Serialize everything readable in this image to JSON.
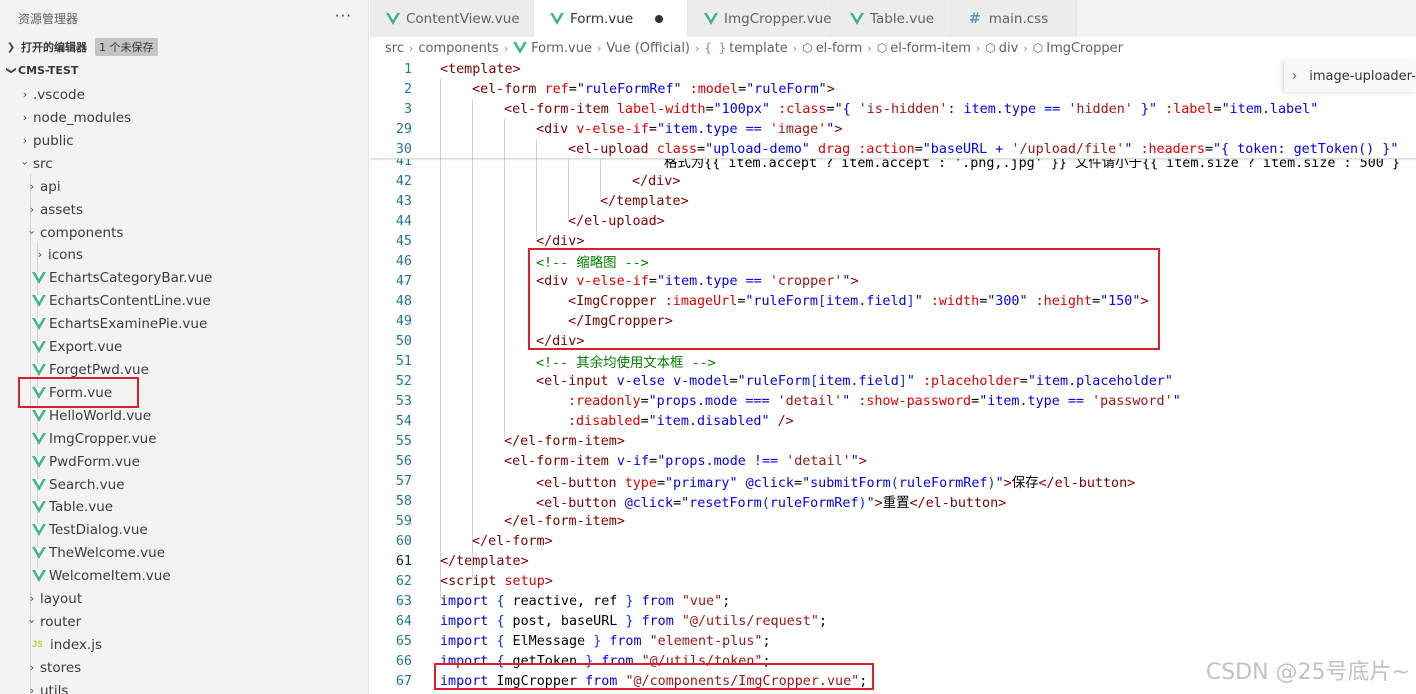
{
  "explorer": {
    "title": "资源管理器",
    "more": "···",
    "open_editors": {
      "label": "打开的编辑器",
      "badge": "1 个未保存"
    },
    "project": "CMS-TEST",
    "tree": [
      {
        "label": ".vscode"
      },
      {
        "label": "node_modules"
      },
      {
        "label": "public"
      },
      {
        "label": "src"
      },
      {
        "label": "api"
      },
      {
        "label": "assets"
      },
      {
        "label": "components"
      },
      {
        "label": "icons"
      },
      {
        "label": "EchartsCategoryBar.vue"
      },
      {
        "label": "EchartsContentLine.vue"
      },
      {
        "label": "EchartsExaminePie.vue"
      },
      {
        "label": "Export.vue"
      },
      {
        "label": "ForgetPwd.vue"
      },
      {
        "label": "Form.vue"
      },
      {
        "label": "HelloWorld.vue"
      },
      {
        "label": "ImgCropper.vue"
      },
      {
        "label": "PwdForm.vue"
      },
      {
        "label": "Search.vue"
      },
      {
        "label": "Table.vue"
      },
      {
        "label": "TestDialog.vue"
      },
      {
        "label": "TheWelcome.vue"
      },
      {
        "label": "WelcomeItem.vue"
      },
      {
        "label": "layout"
      },
      {
        "label": "router"
      },
      {
        "label": "index.js"
      },
      {
        "label": "stores"
      },
      {
        "label": "utils"
      }
    ]
  },
  "tabs": [
    {
      "label": "ContentView.vue"
    },
    {
      "label": "Form.vue"
    },
    {
      "label": "ImgCropper.vue"
    },
    {
      "label": "Table.vue"
    },
    {
      "label": "main.css"
    }
  ],
  "breadcrumb": [
    "src",
    "components",
    "Form.vue",
    "Vue (Official)",
    "template",
    "el-form",
    "el-form-item",
    "div",
    "ImgCropper"
  ],
  "breadcrumb_icons": {
    "template": "{ }"
  },
  "peek": "image-uploader-i",
  "lines": [
    {
      "n": "1"
    },
    {
      "n": "2"
    },
    {
      "n": "3"
    },
    {
      "n": "29"
    },
    {
      "n": "30"
    },
    {
      "n": "41"
    },
    {
      "n": "42"
    },
    {
      "n": "43"
    },
    {
      "n": "44"
    },
    {
      "n": "45"
    },
    {
      "n": "46"
    },
    {
      "n": "47"
    },
    {
      "n": "48"
    },
    {
      "n": "49"
    },
    {
      "n": "50"
    },
    {
      "n": "51"
    },
    {
      "n": "52"
    },
    {
      "n": "53"
    },
    {
      "n": "54"
    },
    {
      "n": "55"
    },
    {
      "n": "56"
    },
    {
      "n": "57"
    },
    {
      "n": "58"
    },
    {
      "n": "59"
    },
    {
      "n": "60"
    },
    {
      "n": "61"
    },
    {
      "n": "62"
    },
    {
      "n": "63"
    },
    {
      "n": "64"
    },
    {
      "n": "65"
    },
    {
      "n": "66"
    },
    {
      "n": "67"
    }
  ],
  "code": {
    "l1_tag": "template",
    "l2_tag": "el-form",
    "l2_a1": "ref",
    "l2_v1": "\"ruleFormRef\"",
    "l2_a2": ":model",
    "l2_v2": "\"ruleForm\"",
    "l3_tag": "el-form-item",
    "l3_a1": "label-width",
    "l3_v1": "\"100px\"",
    "l3_a2": ":class",
    "l3_v2a": "\"{ ",
    "l3_v2b": "'is-hidden'",
    "l3_v2c": ": item.type == ",
    "l3_v2d": "'hidden'",
    "l3_v2e": " }\"",
    "l3_a3": ":label",
    "l3_v3": "\"item.label\"",
    "l29_tag": "div",
    "l29_a1": "v-else-if",
    "l29_v1a": "\"",
    "l29_v1b": "item.type == ",
    "l29_v1c": "'image'",
    "l29_v1d": "\"",
    "l30_tag": "el-upload",
    "l30_a1": "class",
    "l30_v1": "\"upload-demo\"",
    "l30_a2": "drag",
    "l30_a3": ":action",
    "l30_v3a": "\"baseURL + ",
    "l30_v3b": "'/upload/file'",
    "l30_v3c": "\"",
    "l30_a4": ":headers",
    "l30_v4": "\"{ token: getToken() }\"",
    "l41_text": "格式为{{ item.accept ? item.accept : '.png,.jpg' }} 文件请小于{{ item.size ? item.size : 500 }",
    "l42_tag": "/div",
    "l43_tag": "/template",
    "l44_tag": "/el-upload",
    "l45_tag": "/div",
    "l46_comment": "<!-- 缩略图 -->",
    "l47_tag": "div",
    "l47_a1": "v-else-if",
    "l47_v1a": "\"item.type == ",
    "l47_v1b": "'cropper'",
    "l47_v1c": "\"",
    "l48_tag": "ImgCropper",
    "l48_a1": ":imageUrl",
    "l48_v1a": "\"ruleForm",
    "l48_v1b": "[",
    "l48_v1c": "item.field",
    "l48_v1d": "]",
    "l48_v1e": "\"",
    "l48_a2": ":width",
    "l48_v2": "\"300\"",
    "l48_a3": ":height",
    "l48_v3": "\"150\"",
    "l49_tag": "/ImgCropper",
    "l50_tag": "/div",
    "l51_comment": "<!-- 其余均使用文本框 -->",
    "l52_tag": "el-input",
    "l52_a1": "v-else",
    "l52_a2": "v-model",
    "l52_v2a": "\"ruleForm",
    "l52_v2b": "[",
    "l52_v2c": "item.field",
    "l52_v2d": "]",
    "l52_v2e": "\"",
    "l52_a3": ":placeholder",
    "l52_v3": "\"item.placeholder\"",
    "l53_a1": ":readonly",
    "l53_v1a": "\"props.mode === ",
    "l53_v1b": "'detail'",
    "l53_v1c": "\"",
    "l53_a2": ":show-password",
    "l53_v2a": "\"item.type == ",
    "l53_v2b": "'password'",
    "l53_v2c": "\"",
    "l54_a1": ":disabled",
    "l54_v1": "\"item.disabled\"",
    "l54_end": "/>",
    "l55_tag": "/el-form-item",
    "l56_tag": "el-form-item",
    "l56_a1": "v-if",
    "l56_v1a": "\"props.mode !== ",
    "l56_v1b": "'detail'",
    "l56_v1c": "\"",
    "l57_tag": "el-button",
    "l57_a1": "type",
    "l57_v1": "\"primary\"",
    "l57_a2": "@click",
    "l57_v2a": "\"submitForm",
    "l57_v2b": "(",
    "l57_v2c": "ruleFormRef",
    "l57_v2d": ")",
    "l57_v2e": "\"",
    "l57_text": "保存",
    "l57_close": "/el-button",
    "l58_tag": "el-button",
    "l58_a1": "@click",
    "l58_v1a": "\"resetForm",
    "l58_v1b": "(",
    "l58_v1c": "ruleFormRef",
    "l58_v1d": ")",
    "l58_v1e": "\"",
    "l58_text": "重置",
    "l58_close": "/el-button",
    "l59_tag": "/el-form-item",
    "l60_tag": "/el-form",
    "l61_tag": "/template",
    "l62_tag": "script",
    "l62_a1": "setup",
    "l63_kw": "import",
    "l63_body": " reactive, ref ",
    "l63_from": "from",
    "l63_str": "\"vue\"",
    "l64_kw": "import",
    "l64_body": " post, baseURL ",
    "l64_from": "from",
    "l64_str": "\"@/utils/request\"",
    "l65_kw": "import",
    "l65_body": " ElMessage ",
    "l65_from": "from",
    "l65_str": "\"element-plus\"",
    "l66_kw": "import",
    "l66_body": " getToken ",
    "l66_from": "from",
    "l66_str": "\"@/utils/token\"",
    "l67_kw": "import",
    "l67_body": " ImgCropper ",
    "l67_from": "from",
    "l67_str": "\"@/components/ImgCropper.vue\""
  },
  "watermark": "CSDN @25号底片~"
}
